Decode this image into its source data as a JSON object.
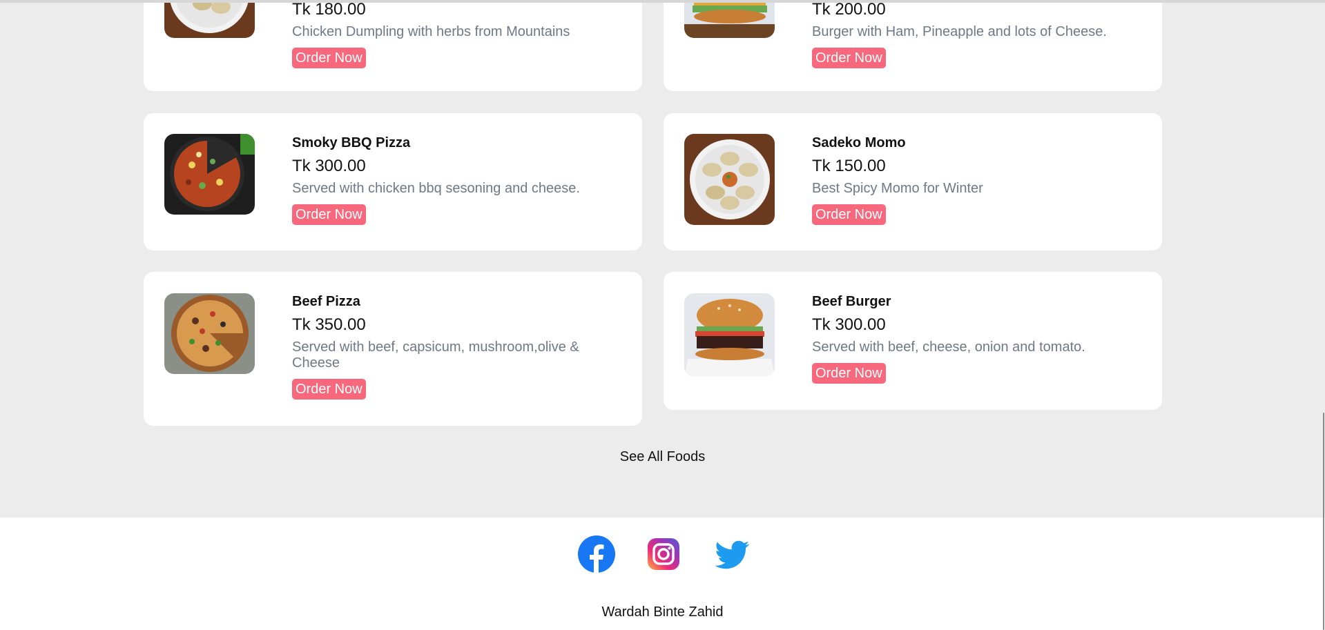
{
  "foods": {
    "row0": {
      "left": {
        "price": "Tk 180.00",
        "desc": "Chicken Dumpling with herbs from Mountains",
        "order_label": "Order Now"
      },
      "right": {
        "price": "Tk 200.00",
        "desc": "Burger with Ham, Pineapple and lots of Cheese.",
        "order_label": "Order Now"
      }
    },
    "row1": {
      "left": {
        "name": "Smoky BBQ Pizza",
        "price": "Tk 300.00",
        "desc": "Served with chicken bbq sesoning and cheese.",
        "order_label": "Order Now"
      },
      "right": {
        "name": "Sadeko Momo",
        "price": "Tk 150.00",
        "desc": "Best Spicy Momo for Winter",
        "order_label": "Order Now"
      }
    },
    "row2": {
      "left": {
        "name": "Beef Pizza",
        "price": "Tk 350.00",
        "desc": "Served with beef, capsicum, mushroom,olive & Cheese",
        "order_label": "Order Now"
      },
      "right": {
        "name": "Beef Burger",
        "price": "Tk 300.00",
        "desc": "Served with beef, cheese, onion and tomato.",
        "order_label": "Order Now"
      }
    }
  },
  "see_all_label": "See All Foods",
  "footer": {
    "social": [
      "facebook-icon",
      "instagram-icon",
      "twitter-icon"
    ],
    "credit": "Wardah Binte Zahid"
  },
  "colors": {
    "accent": "#f7687c",
    "page_bg": "#ececec",
    "desc_text": "#6f7886"
  }
}
